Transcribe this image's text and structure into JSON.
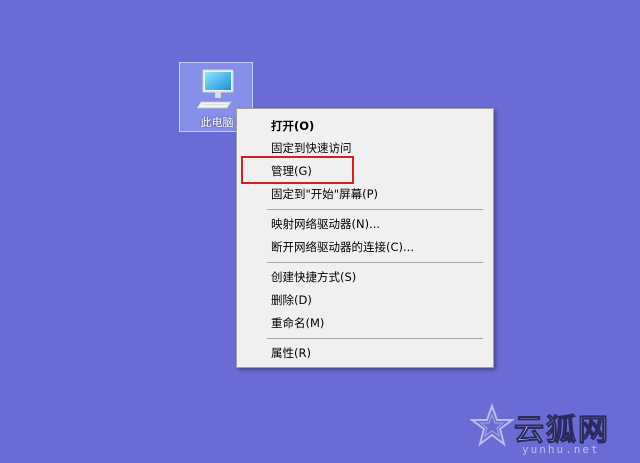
{
  "desktop": {
    "background_color": "#6b6bd6",
    "icon": {
      "label": "此电脑",
      "icon_name": "this-pc-icon"
    }
  },
  "context_menu": {
    "items": [
      {
        "label": "打开(O)",
        "bold": true
      },
      {
        "label": "固定到快速访问"
      },
      {
        "label": "管理(G)",
        "highlighted": true
      },
      {
        "label": "固定到\"开始\"屏幕(P)"
      },
      {
        "label": "映射网络驱动器(N)..."
      },
      {
        "label": "断开网络驱动器的连接(C)..."
      },
      {
        "label": "创建快捷方式(S)"
      },
      {
        "label": "删除(D)"
      },
      {
        "label": "重命名(M)"
      },
      {
        "label": "属性(R)"
      }
    ],
    "highlight_color": "#d42020"
  },
  "watermark": {
    "brand": "云狐网",
    "domain": "yunhu.net",
    "icon_name": "star-logo-icon"
  }
}
